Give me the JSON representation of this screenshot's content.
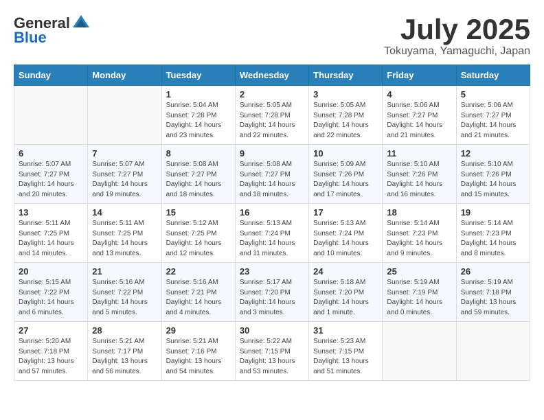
{
  "logo": {
    "general": "General",
    "blue": "Blue"
  },
  "title": {
    "month_year": "July 2025",
    "location": "Tokuyama, Yamaguchi, Japan"
  },
  "headers": [
    "Sunday",
    "Monday",
    "Tuesday",
    "Wednesday",
    "Thursday",
    "Friday",
    "Saturday"
  ],
  "weeks": [
    [
      {
        "day": "",
        "info": ""
      },
      {
        "day": "",
        "info": ""
      },
      {
        "day": "1",
        "info": "Sunrise: 5:04 AM\nSunset: 7:28 PM\nDaylight: 14 hours and 23 minutes."
      },
      {
        "day": "2",
        "info": "Sunrise: 5:05 AM\nSunset: 7:28 PM\nDaylight: 14 hours and 22 minutes."
      },
      {
        "day": "3",
        "info": "Sunrise: 5:05 AM\nSunset: 7:28 PM\nDaylight: 14 hours and 22 minutes."
      },
      {
        "day": "4",
        "info": "Sunrise: 5:06 AM\nSunset: 7:27 PM\nDaylight: 14 hours and 21 minutes."
      },
      {
        "day": "5",
        "info": "Sunrise: 5:06 AM\nSunset: 7:27 PM\nDaylight: 14 hours and 21 minutes."
      }
    ],
    [
      {
        "day": "6",
        "info": "Sunrise: 5:07 AM\nSunset: 7:27 PM\nDaylight: 14 hours and 20 minutes."
      },
      {
        "day": "7",
        "info": "Sunrise: 5:07 AM\nSunset: 7:27 PM\nDaylight: 14 hours and 19 minutes."
      },
      {
        "day": "8",
        "info": "Sunrise: 5:08 AM\nSunset: 7:27 PM\nDaylight: 14 hours and 18 minutes."
      },
      {
        "day": "9",
        "info": "Sunrise: 5:08 AM\nSunset: 7:27 PM\nDaylight: 14 hours and 18 minutes."
      },
      {
        "day": "10",
        "info": "Sunrise: 5:09 AM\nSunset: 7:26 PM\nDaylight: 14 hours and 17 minutes."
      },
      {
        "day": "11",
        "info": "Sunrise: 5:10 AM\nSunset: 7:26 PM\nDaylight: 14 hours and 16 minutes."
      },
      {
        "day": "12",
        "info": "Sunrise: 5:10 AM\nSunset: 7:26 PM\nDaylight: 14 hours and 15 minutes."
      }
    ],
    [
      {
        "day": "13",
        "info": "Sunrise: 5:11 AM\nSunset: 7:25 PM\nDaylight: 14 hours and 14 minutes."
      },
      {
        "day": "14",
        "info": "Sunrise: 5:11 AM\nSunset: 7:25 PM\nDaylight: 14 hours and 13 minutes."
      },
      {
        "day": "15",
        "info": "Sunrise: 5:12 AM\nSunset: 7:25 PM\nDaylight: 14 hours and 12 minutes."
      },
      {
        "day": "16",
        "info": "Sunrise: 5:13 AM\nSunset: 7:24 PM\nDaylight: 14 hours and 11 minutes."
      },
      {
        "day": "17",
        "info": "Sunrise: 5:13 AM\nSunset: 7:24 PM\nDaylight: 14 hours and 10 minutes."
      },
      {
        "day": "18",
        "info": "Sunrise: 5:14 AM\nSunset: 7:23 PM\nDaylight: 14 hours and 9 minutes."
      },
      {
        "day": "19",
        "info": "Sunrise: 5:14 AM\nSunset: 7:23 PM\nDaylight: 14 hours and 8 minutes."
      }
    ],
    [
      {
        "day": "20",
        "info": "Sunrise: 5:15 AM\nSunset: 7:22 PM\nDaylight: 14 hours and 6 minutes."
      },
      {
        "day": "21",
        "info": "Sunrise: 5:16 AM\nSunset: 7:22 PM\nDaylight: 14 hours and 5 minutes."
      },
      {
        "day": "22",
        "info": "Sunrise: 5:16 AM\nSunset: 7:21 PM\nDaylight: 14 hours and 4 minutes."
      },
      {
        "day": "23",
        "info": "Sunrise: 5:17 AM\nSunset: 7:20 PM\nDaylight: 14 hours and 3 minutes."
      },
      {
        "day": "24",
        "info": "Sunrise: 5:18 AM\nSunset: 7:20 PM\nDaylight: 14 hours and 1 minute."
      },
      {
        "day": "25",
        "info": "Sunrise: 5:19 AM\nSunset: 7:19 PM\nDaylight: 14 hours and 0 minutes."
      },
      {
        "day": "26",
        "info": "Sunrise: 5:19 AM\nSunset: 7:18 PM\nDaylight: 13 hours and 59 minutes."
      }
    ],
    [
      {
        "day": "27",
        "info": "Sunrise: 5:20 AM\nSunset: 7:18 PM\nDaylight: 13 hours and 57 minutes."
      },
      {
        "day": "28",
        "info": "Sunrise: 5:21 AM\nSunset: 7:17 PM\nDaylight: 13 hours and 56 minutes."
      },
      {
        "day": "29",
        "info": "Sunrise: 5:21 AM\nSunset: 7:16 PM\nDaylight: 13 hours and 54 minutes."
      },
      {
        "day": "30",
        "info": "Sunrise: 5:22 AM\nSunset: 7:15 PM\nDaylight: 13 hours and 53 minutes."
      },
      {
        "day": "31",
        "info": "Sunrise: 5:23 AM\nSunset: 7:15 PM\nDaylight: 13 hours and 51 minutes."
      },
      {
        "day": "",
        "info": ""
      },
      {
        "day": "",
        "info": ""
      }
    ]
  ]
}
